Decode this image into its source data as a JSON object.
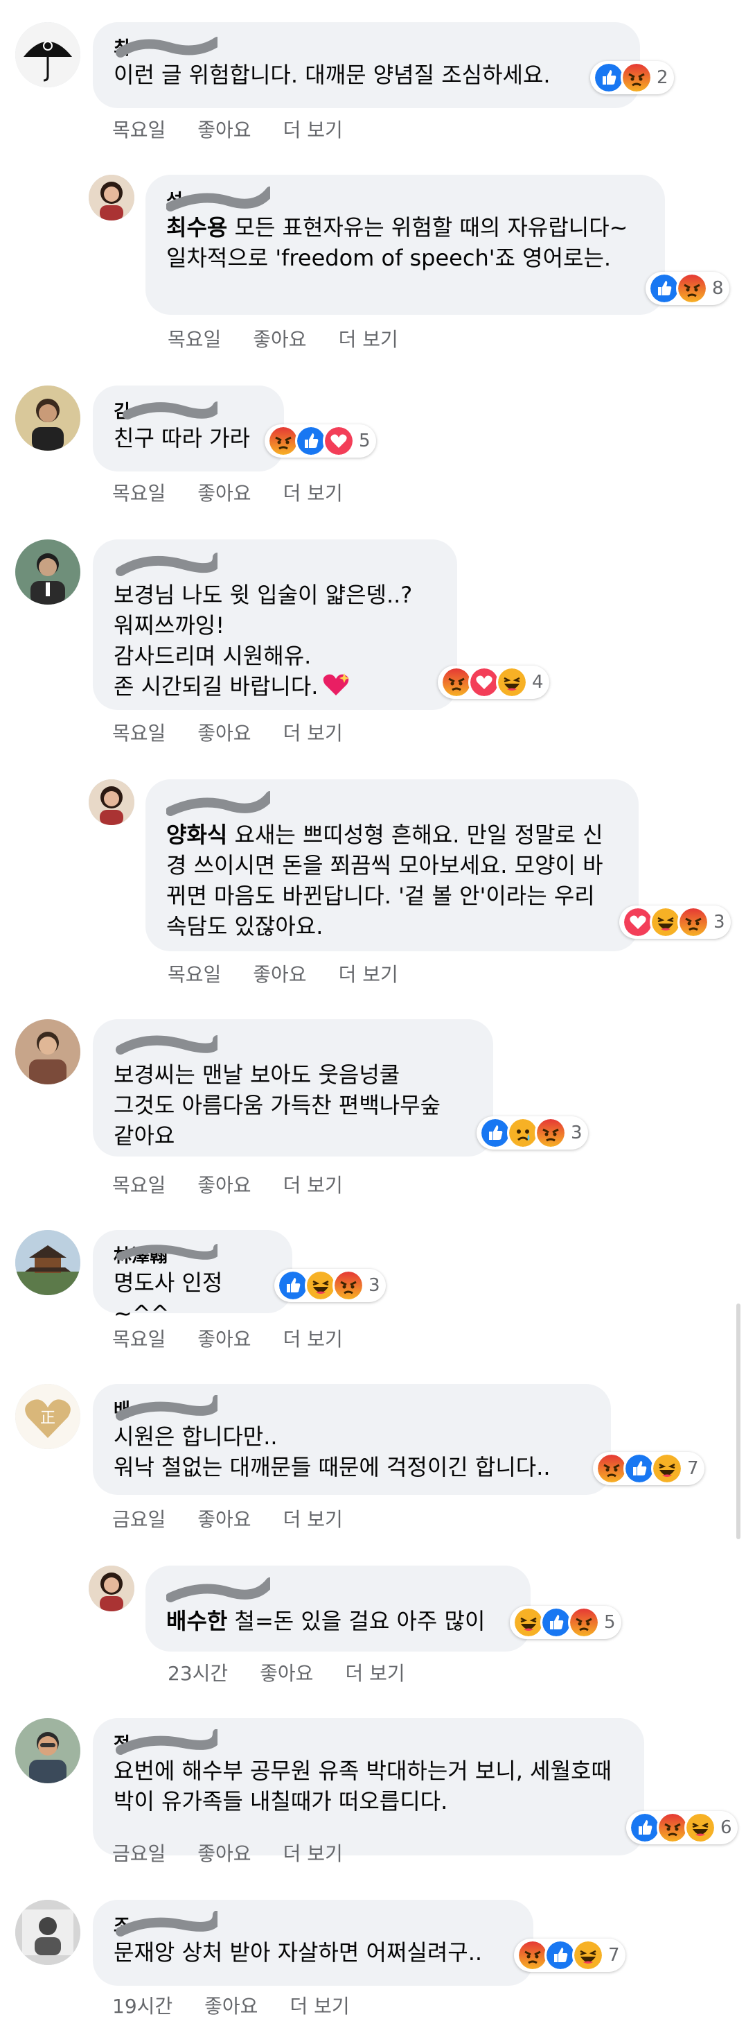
{
  "labels": {
    "like": "좋아요",
    "more": "더 보기"
  },
  "comments": [
    {
      "author": "최 ",
      "text": "이런 글 위험합니다. 대깨문 양념질 조심하세요.",
      "mention": "",
      "time": "목요일",
      "reaction_count": "2",
      "reactions": [
        "like",
        "angry"
      ],
      "avatar_icon": "umbrella-icon"
    },
    {
      "author": "  성",
      "mention": "최수용",
      "text": " 모든 표현자유는 위험할 때의 자유랍니다~ 일차적으로 'freedom of speech'죠 영어로는.",
      "time": "목요일",
      "reaction_count": "8",
      "reactions": [
        "like",
        "angry"
      ],
      "avatar_icon": "woman-icon"
    },
    {
      "author": "김 ",
      "text": "친구 따라 가라",
      "mention": "",
      "time": "목요일",
      "reaction_count": "5",
      "reactions": [
        "angry",
        "like",
        "love"
      ],
      "avatar_icon": "man-icon"
    },
    {
      "author": "  ",
      "text": "보경님 나도 윗 입술이 얇은뎅..?\n워찌쓰까잉!\n감사드리며 시원해유.\n존 시간되길 바랍니다.",
      "mention": "",
      "time": "목요일",
      "reaction_count": "4",
      "reactions": [
        "angry",
        "love",
        "haha"
      ],
      "avatar_icon": "man-icon"
    },
    {
      "author": "  ",
      "mention": "양화식",
      "text": " 요새는 쁘띠성형 흔해요. 만일 정말로 신경 쓰이시면 돈을 쬐끔씩 모아보세요. 모양이 바뀌면 마음도 바뀐답니다. '겉 볼 안'이라는 우리 속담도 있잖아요.",
      "time": "목요일",
      "reaction_count": "3",
      "reactions": [
        "love",
        "haha",
        "angry"
      ],
      "avatar_icon": "woman-icon"
    },
    {
      "author": "  ",
      "text": "보경씨는 맨날 보아도 웃음넝쿨\n그것도 아름다움 가득찬 편백나무숲\n같아요",
      "mention": "",
      "time": "목요일",
      "reaction_count": "3",
      "reactions": [
        "like",
        "sad",
        "angry"
      ],
      "avatar_icon": "man-icon"
    },
    {
      "author": "林澤翰",
      "text": "명도사 인정~^^",
      "mention": "",
      "time": "목요일",
      "reaction_count": "3",
      "reactions": [
        "like",
        "haha",
        "angry"
      ],
      "avatar_icon": "pagoda-icon"
    },
    {
      "author": "배 ",
      "text": "시원은 합니다만..\n워낙 철없는 대깨문들 때문에 걱정이긴 합니다..",
      "mention": "",
      "time": "금요일",
      "reaction_count": "7",
      "reactions": [
        "angry",
        "like",
        "haha"
      ],
      "avatar_icon": "heart-logo-icon"
    },
    {
      "author": "  ",
      "mention": "배수한",
      "text": " 철=돈 있을 걸요 아주 많이",
      "time": "23시간",
      "reaction_count": "5",
      "reactions": [
        "haha",
        "like",
        "angry"
      ],
      "avatar_icon": "woman-icon"
    },
    {
      "author": "정 ",
      "text": "요번에 해수부 공무원 유족 박대하는거 보니, 세월호때 박이 유가족들 내칠때가 떠오릅디다.",
      "mention": "",
      "time": "금요일",
      "reaction_count": "6",
      "reactions": [
        "like",
        "angry",
        "haha"
      ],
      "avatar_icon": "man-icon"
    },
    {
      "author": "조 ",
      "text": "문재앙 상처 받아 자살하면 어쩌실려구..",
      "mention": "",
      "time": "19시간",
      "reaction_count": "7",
      "reactions": [
        "angry",
        "like",
        "haha"
      ],
      "avatar_icon": "man-icon"
    }
  ],
  "colors": {
    "bubble": "#f0f2f5",
    "meta": "#65676b",
    "like": "#1877f2",
    "love": "#f33e58",
    "haha": "#f7b125",
    "angry": "#e9710f"
  }
}
